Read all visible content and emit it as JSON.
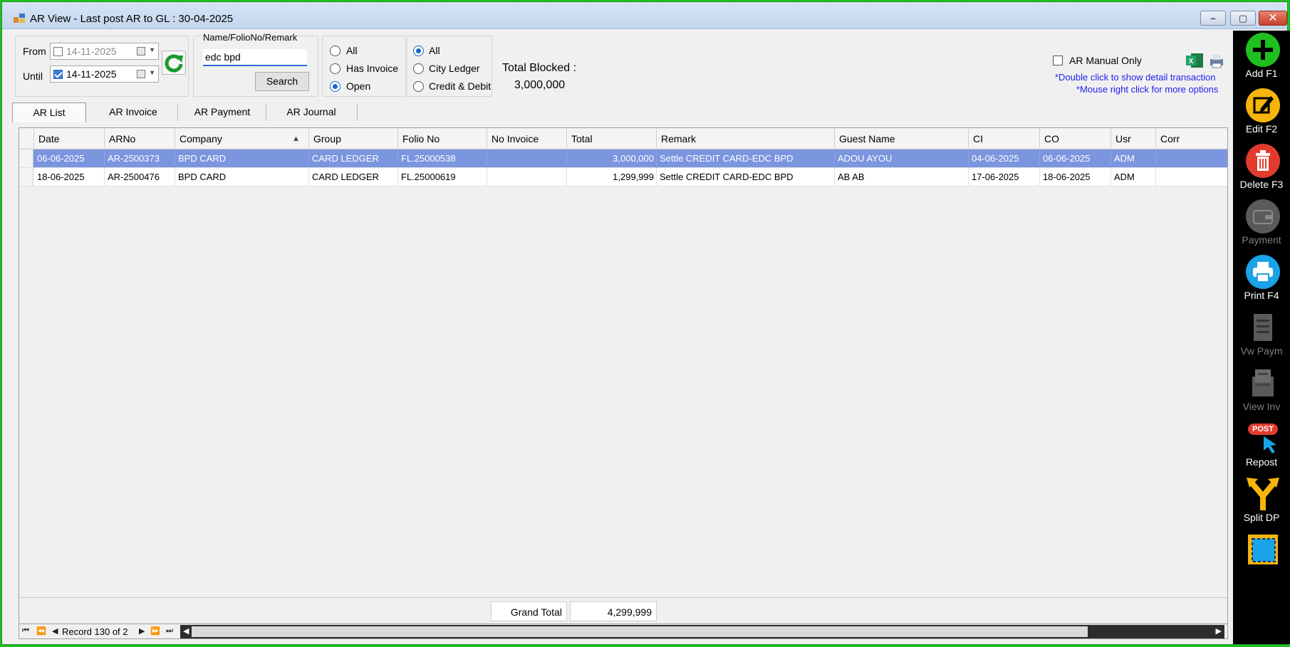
{
  "window": {
    "title": "AR View - Last post AR to GL : 30-04-2025",
    "min": "–",
    "max": "▢",
    "close": "✕"
  },
  "filters": {
    "from_label": "From",
    "until_label": "Until",
    "from_date": "14-11-2025",
    "until_date": "14-11-2025",
    "name_label": "Name/FolioNo/Remark",
    "search_value": "edc bpd",
    "search_button": "Search",
    "invoice_options": [
      "All",
      "Has Invoice",
      "Open"
    ],
    "invoice_selected": "Open",
    "ledger_options": [
      "All",
      "City Ledger",
      "Credit & Debit"
    ],
    "ledger_selected": "All",
    "total_blocked_label": "Total Blocked :",
    "total_blocked_value": "3,000,000",
    "ar_manual_only": "AR Manual Only",
    "hint1": "*Double click to show detail transaction",
    "hint2": "*Mouse right click for more options"
  },
  "tabs": [
    "AR List",
    "AR Invoice",
    "AR Payment",
    "AR Journal"
  ],
  "grid": {
    "columns": [
      "Date",
      "ARNo",
      "Company",
      "Group",
      "Folio No",
      "No Invoice",
      "Total",
      "Remark",
      "Guest Name",
      "CI",
      "CO",
      "Usr",
      "Corr"
    ],
    "sort_indicator": "▲",
    "rows": [
      [
        "06-06-2025",
        "AR-2500373",
        "BPD CARD",
        "CARD LEDGER",
        "FL.25000538",
        "",
        "3,000,000",
        "Settle CREDIT CARD-EDC BPD",
        "ADOU AYOU",
        "04-06-2025",
        "06-06-2025",
        "ADM",
        ""
      ],
      [
        "18-06-2025",
        "AR-2500476",
        "BPD CARD",
        "CARD LEDGER",
        "FL.25000619",
        "",
        "1,299,999",
        "Settle CREDIT CARD-EDC BPD",
        "AB AB",
        "17-06-2025",
        "18-06-2025",
        "ADM",
        ""
      ]
    ],
    "grand_total_label": "Grand Total",
    "grand_total_value": "4,299,999"
  },
  "navigator": {
    "record_text": "Record 130 of 2"
  },
  "toolbar": [
    {
      "label": "Add F1",
      "icon": "add-icon",
      "enabled": true
    },
    {
      "label": "Edit F2",
      "icon": "edit-icon",
      "enabled": true
    },
    {
      "label": "Delete F3",
      "icon": "trash-icon",
      "enabled": true
    },
    {
      "label": "Payment",
      "icon": "wallet-icon",
      "enabled": false
    },
    {
      "label": "Print F4",
      "icon": "printer-icon",
      "enabled": true
    },
    {
      "label": "Vw Paym",
      "icon": "document-list-icon",
      "enabled": false
    },
    {
      "label": "View Inv",
      "icon": "invoice-icon",
      "enabled": false
    },
    {
      "label": "Repost",
      "icon": "post-cursor-icon",
      "enabled": true,
      "badge": "POST"
    },
    {
      "label": "Split DP",
      "icon": "split-arrow-icon",
      "enabled": true
    },
    {
      "label": "",
      "icon": "select-region-icon",
      "enabled": true
    }
  ],
  "colors": {
    "selected_row": "#7b95df",
    "accent_blue": "#1e66c8",
    "hint_blue": "#1d1df0",
    "add_green": "#1fbf1f",
    "edit_yellow": "#f5b50a",
    "delete_red": "#e23b2e",
    "print_blue": "#1aa3e8"
  }
}
